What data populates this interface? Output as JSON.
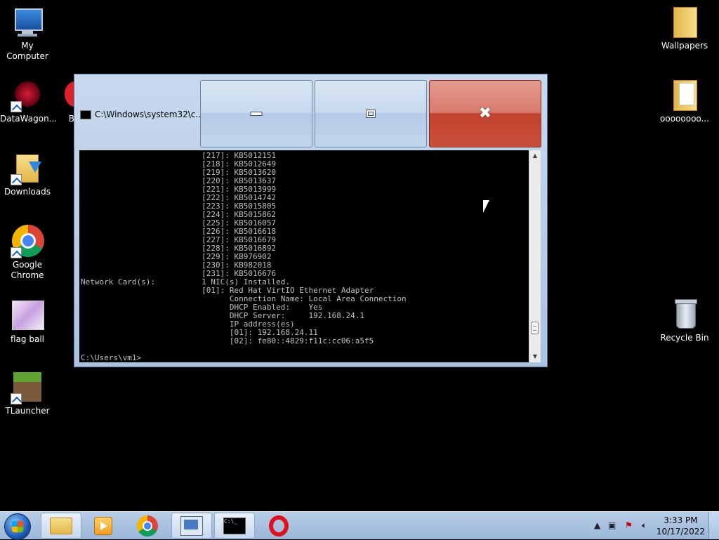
{
  "desktop": {
    "icons_left": [
      {
        "label": "My Computer",
        "icon": "computer-icon"
      },
      {
        "label": "DataWagon...",
        "icon": "datawagon-icon"
      },
      {
        "label": "Downloads",
        "icon": "downloads-folder-icon"
      },
      {
        "label": "Google Chrome",
        "icon": "chrome-icon"
      },
      {
        "label": "flag ball",
        "icon": "flag-ball-icon"
      },
      {
        "label": "TLauncher",
        "icon": "tlauncher-icon"
      }
    ],
    "partial_icon_label": "B",
    "icons_right": [
      {
        "label": "Wallpapers",
        "icon": "folder-icon"
      },
      {
        "label": "oooooooo...",
        "icon": "folder-icon"
      },
      {
        "label": "Recycle Bin",
        "icon": "recycle-bin-icon"
      }
    ]
  },
  "window": {
    "title": "C:\\Windows\\system32\\c...",
    "minimize_glyph": "",
    "maximize_glyph": "",
    "close_glyph": "✖",
    "console_lines": [
      "                          [217]: KB5012151",
      "                          [218]: KB5012649",
      "                          [219]: KB5013620",
      "                          [220]: KB5013637",
      "                          [221]: KB5013999",
      "                          [222]: KB5014742",
      "                          [223]: KB5015805",
      "                          [224]: KB5015862",
      "                          [225]: KB5016057",
      "                          [226]: KB5016618",
      "                          [227]: KB5016679",
      "                          [228]: KB5016892",
      "                          [229]: KB976902",
      "                          [230]: KB982018",
      "                          [231]: KB5016676",
      "Network Card(s):          1 NIC(s) Installed.",
      "                          [01]: Red Hat VirtIO Ethernet Adapter",
      "                                Connection Name: Local Area Connection",
      "                                DHCP Enabled:    Yes",
      "                                DHCP Server:     192.168.24.1",
      "                                IP address(es)",
      "                                [01]: 192.168.24.11",
      "                                [02]: fe80::4829:f11c:cc06:a5f5",
      "",
      "C:\\Users\\vm1>"
    ]
  },
  "taskbar": {
    "items": [
      {
        "name": "explorer",
        "icon": "folder-icon"
      },
      {
        "name": "media-player",
        "icon": "media-player-icon"
      },
      {
        "name": "chrome",
        "icon": "chrome-icon"
      },
      {
        "name": "network",
        "icon": "network-icon"
      },
      {
        "name": "cmd",
        "icon": "cmd-icon",
        "text": "C:\\_"
      },
      {
        "name": "opera",
        "icon": "opera-icon"
      }
    ],
    "clock_time": "3:33 PM",
    "clock_date": "10/17/2022"
  }
}
